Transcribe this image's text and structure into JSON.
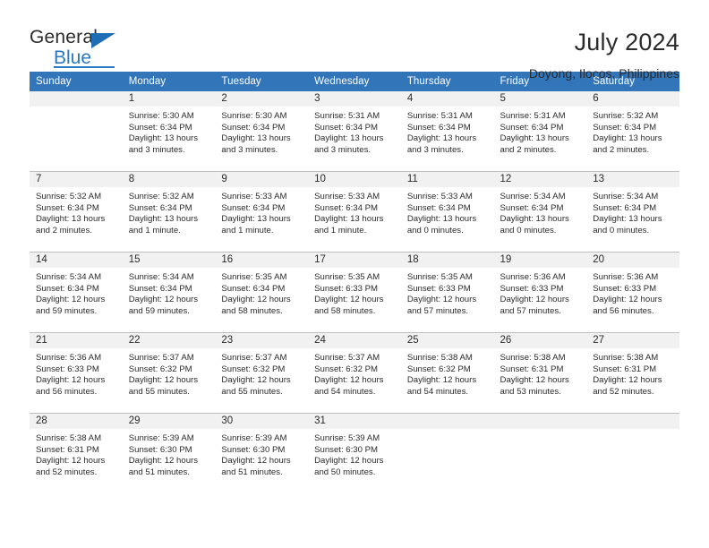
{
  "brand": {
    "name_part1": "General",
    "name_part2": "Blue",
    "accent_color": "#2b78c2"
  },
  "header": {
    "title": "July 2024",
    "subtitle": "Doyong, Ilocos, Philippines"
  },
  "calendar": {
    "header_bg": "#3275b8",
    "daynum_bg": "#f1f1f1",
    "weekday_names": [
      "Sunday",
      "Monday",
      "Tuesday",
      "Wednesday",
      "Thursday",
      "Friday",
      "Saturday"
    ],
    "weeks": [
      [
        {
          "day": "",
          "sunrise": "",
          "sunset": "",
          "daylight_line1": "",
          "daylight_line2": "",
          "empty": true
        },
        {
          "day": "1",
          "sunrise": "Sunrise: 5:30 AM",
          "sunset": "Sunset: 6:34 PM",
          "daylight_line1": "Daylight: 13 hours",
          "daylight_line2": "and 3 minutes."
        },
        {
          "day": "2",
          "sunrise": "Sunrise: 5:30 AM",
          "sunset": "Sunset: 6:34 PM",
          "daylight_line1": "Daylight: 13 hours",
          "daylight_line2": "and 3 minutes."
        },
        {
          "day": "3",
          "sunrise": "Sunrise: 5:31 AM",
          "sunset": "Sunset: 6:34 PM",
          "daylight_line1": "Daylight: 13 hours",
          "daylight_line2": "and 3 minutes."
        },
        {
          "day": "4",
          "sunrise": "Sunrise: 5:31 AM",
          "sunset": "Sunset: 6:34 PM",
          "daylight_line1": "Daylight: 13 hours",
          "daylight_line2": "and 3 minutes."
        },
        {
          "day": "5",
          "sunrise": "Sunrise: 5:31 AM",
          "sunset": "Sunset: 6:34 PM",
          "daylight_line1": "Daylight: 13 hours",
          "daylight_line2": "and 2 minutes."
        },
        {
          "day": "6",
          "sunrise": "Sunrise: 5:32 AM",
          "sunset": "Sunset: 6:34 PM",
          "daylight_line1": "Daylight: 13 hours",
          "daylight_line2": "and 2 minutes."
        }
      ],
      [
        {
          "day": "7",
          "sunrise": "Sunrise: 5:32 AM",
          "sunset": "Sunset: 6:34 PM",
          "daylight_line1": "Daylight: 13 hours",
          "daylight_line2": "and 2 minutes."
        },
        {
          "day": "8",
          "sunrise": "Sunrise: 5:32 AM",
          "sunset": "Sunset: 6:34 PM",
          "daylight_line1": "Daylight: 13 hours",
          "daylight_line2": "and 1 minute."
        },
        {
          "day": "9",
          "sunrise": "Sunrise: 5:33 AM",
          "sunset": "Sunset: 6:34 PM",
          "daylight_line1": "Daylight: 13 hours",
          "daylight_line2": "and 1 minute."
        },
        {
          "day": "10",
          "sunrise": "Sunrise: 5:33 AM",
          "sunset": "Sunset: 6:34 PM",
          "daylight_line1": "Daylight: 13 hours",
          "daylight_line2": "and 1 minute."
        },
        {
          "day": "11",
          "sunrise": "Sunrise: 5:33 AM",
          "sunset": "Sunset: 6:34 PM",
          "daylight_line1": "Daylight: 13 hours",
          "daylight_line2": "and 0 minutes."
        },
        {
          "day": "12",
          "sunrise": "Sunrise: 5:34 AM",
          "sunset": "Sunset: 6:34 PM",
          "daylight_line1": "Daylight: 13 hours",
          "daylight_line2": "and 0 minutes."
        },
        {
          "day": "13",
          "sunrise": "Sunrise: 5:34 AM",
          "sunset": "Sunset: 6:34 PM",
          "daylight_line1": "Daylight: 13 hours",
          "daylight_line2": "and 0 minutes."
        }
      ],
      [
        {
          "day": "14",
          "sunrise": "Sunrise: 5:34 AM",
          "sunset": "Sunset: 6:34 PM",
          "daylight_line1": "Daylight: 12 hours",
          "daylight_line2": "and 59 minutes."
        },
        {
          "day": "15",
          "sunrise": "Sunrise: 5:34 AM",
          "sunset": "Sunset: 6:34 PM",
          "daylight_line1": "Daylight: 12 hours",
          "daylight_line2": "and 59 minutes."
        },
        {
          "day": "16",
          "sunrise": "Sunrise: 5:35 AM",
          "sunset": "Sunset: 6:34 PM",
          "daylight_line1": "Daylight: 12 hours",
          "daylight_line2": "and 58 minutes."
        },
        {
          "day": "17",
          "sunrise": "Sunrise: 5:35 AM",
          "sunset": "Sunset: 6:33 PM",
          "daylight_line1": "Daylight: 12 hours",
          "daylight_line2": "and 58 minutes."
        },
        {
          "day": "18",
          "sunrise": "Sunrise: 5:35 AM",
          "sunset": "Sunset: 6:33 PM",
          "daylight_line1": "Daylight: 12 hours",
          "daylight_line2": "and 57 minutes."
        },
        {
          "day": "19",
          "sunrise": "Sunrise: 5:36 AM",
          "sunset": "Sunset: 6:33 PM",
          "daylight_line1": "Daylight: 12 hours",
          "daylight_line2": "and 57 minutes."
        },
        {
          "day": "20",
          "sunrise": "Sunrise: 5:36 AM",
          "sunset": "Sunset: 6:33 PM",
          "daylight_line1": "Daylight: 12 hours",
          "daylight_line2": "and 56 minutes."
        }
      ],
      [
        {
          "day": "21",
          "sunrise": "Sunrise: 5:36 AM",
          "sunset": "Sunset: 6:33 PM",
          "daylight_line1": "Daylight: 12 hours",
          "daylight_line2": "and 56 minutes."
        },
        {
          "day": "22",
          "sunrise": "Sunrise: 5:37 AM",
          "sunset": "Sunset: 6:32 PM",
          "daylight_line1": "Daylight: 12 hours",
          "daylight_line2": "and 55 minutes."
        },
        {
          "day": "23",
          "sunrise": "Sunrise: 5:37 AM",
          "sunset": "Sunset: 6:32 PM",
          "daylight_line1": "Daylight: 12 hours",
          "daylight_line2": "and 55 minutes."
        },
        {
          "day": "24",
          "sunrise": "Sunrise: 5:37 AM",
          "sunset": "Sunset: 6:32 PM",
          "daylight_line1": "Daylight: 12 hours",
          "daylight_line2": "and 54 minutes."
        },
        {
          "day": "25",
          "sunrise": "Sunrise: 5:38 AM",
          "sunset": "Sunset: 6:32 PM",
          "daylight_line1": "Daylight: 12 hours",
          "daylight_line2": "and 54 minutes."
        },
        {
          "day": "26",
          "sunrise": "Sunrise: 5:38 AM",
          "sunset": "Sunset: 6:31 PM",
          "daylight_line1": "Daylight: 12 hours",
          "daylight_line2": "and 53 minutes."
        },
        {
          "day": "27",
          "sunrise": "Sunrise: 5:38 AM",
          "sunset": "Sunset: 6:31 PM",
          "daylight_line1": "Daylight: 12 hours",
          "daylight_line2": "and 52 minutes."
        }
      ],
      [
        {
          "day": "28",
          "sunrise": "Sunrise: 5:38 AM",
          "sunset": "Sunset: 6:31 PM",
          "daylight_line1": "Daylight: 12 hours",
          "daylight_line2": "and 52 minutes."
        },
        {
          "day": "29",
          "sunrise": "Sunrise: 5:39 AM",
          "sunset": "Sunset: 6:30 PM",
          "daylight_line1": "Daylight: 12 hours",
          "daylight_line2": "and 51 minutes."
        },
        {
          "day": "30",
          "sunrise": "Sunrise: 5:39 AM",
          "sunset": "Sunset: 6:30 PM",
          "daylight_line1": "Daylight: 12 hours",
          "daylight_line2": "and 51 minutes."
        },
        {
          "day": "31",
          "sunrise": "Sunrise: 5:39 AM",
          "sunset": "Sunset: 6:30 PM",
          "daylight_line1": "Daylight: 12 hours",
          "daylight_line2": "and 50 minutes."
        },
        {
          "day": "",
          "sunrise": "",
          "sunset": "",
          "daylight_line1": "",
          "daylight_line2": "",
          "empty": true
        },
        {
          "day": "",
          "sunrise": "",
          "sunset": "",
          "daylight_line1": "",
          "daylight_line2": "",
          "empty": true
        },
        {
          "day": "",
          "sunrise": "",
          "sunset": "",
          "daylight_line1": "",
          "daylight_line2": "",
          "empty": true
        }
      ]
    ]
  }
}
